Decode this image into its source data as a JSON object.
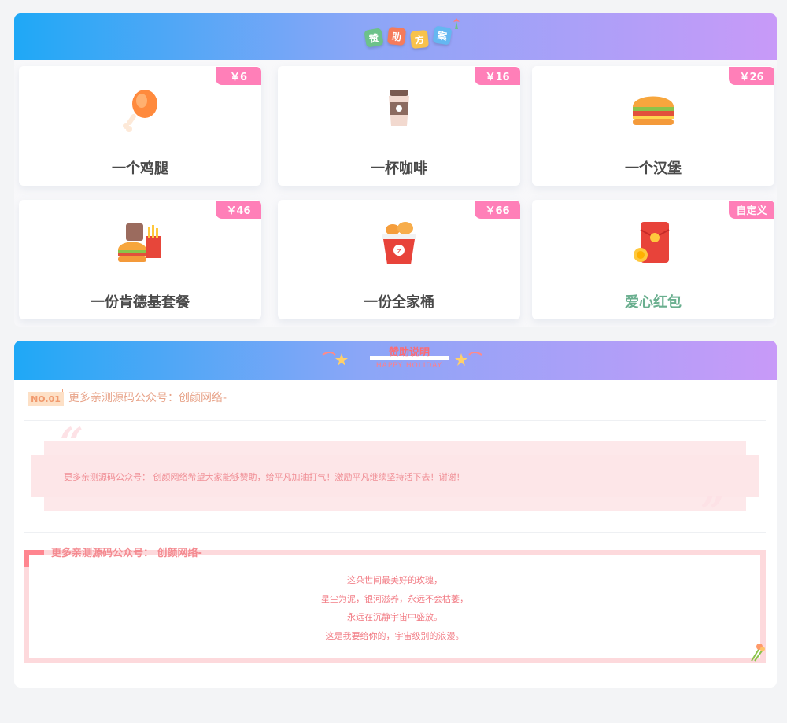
{
  "sponsor": {
    "title_chars": [
      "赞",
      "助",
      "方",
      "案"
    ],
    "items": [
      {
        "name": "一个鸡腿",
        "price": "￥6",
        "icon": "drumstick-icon"
      },
      {
        "name": "一杯咖啡",
        "price": "￥16",
        "icon": "coffee-cup-icon"
      },
      {
        "name": "一个汉堡",
        "price": "￥26",
        "icon": "burger-icon"
      },
      {
        "name": "一份肯德基套餐",
        "price": "￥46",
        "icon": "combo-meal-icon"
      },
      {
        "name": "一份全家桶",
        "price": "￥66",
        "icon": "chicken-bucket-icon"
      },
      {
        "name": "爱心红包",
        "price": "自定义",
        "icon": "red-envelope-icon"
      }
    ]
  },
  "explain": {
    "title": "赞助说明",
    "subtitle": "HAPPY HOLIDAY",
    "no_badge": "NO.01",
    "no_text": "更多亲测源码公众号：创颜网络-",
    "quote": "更多亲测源码公众号： 创颜网络希望大家能够赞助，给平凡加油打气！激励平凡继续坚持活下去！谢谢！",
    "poem_title": "更多亲测源码公众号： 创颜网络-",
    "poem_lines": [
      "这朵世间最美好的玫瑰，",
      "星尘为泥，银河滋养，永远不会枯萎，",
      "永远在沉静宇宙中盛放。",
      "这是我要给你的，宇宙级别的浪漫。"
    ]
  },
  "colors": {
    "header_gradient": [
      "#1fa8f6",
      "#c89af8"
    ],
    "price_badge": "#ff7fb8",
    "accent_pink": "#ff858f"
  }
}
